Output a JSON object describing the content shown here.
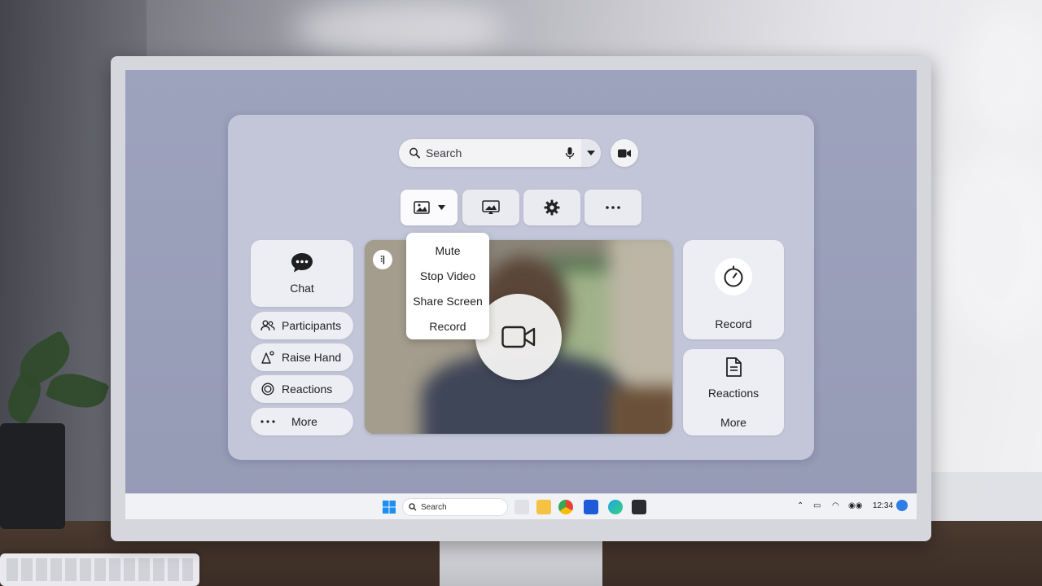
{
  "search": {
    "placeholder": "Search"
  },
  "dropdown_menu": {
    "items": [
      "Mute",
      "Stop Video",
      "Share Screen",
      "Record"
    ]
  },
  "left_panel": {
    "chat_label": "Chat",
    "pills": [
      {
        "label": "Participants",
        "icon": "participants-icon"
      },
      {
        "label": "Raise Hand",
        "icon": "raise-hand-icon"
      },
      {
        "label": "Reactions",
        "icon": "reactions-icon"
      },
      {
        "label": "More",
        "icon": "more-icon"
      }
    ]
  },
  "right_panel": {
    "record_label": "Record",
    "reactions_label": "Reactions",
    "more_label": "More"
  },
  "video": {
    "badge": "⫶|"
  },
  "taskbar": {
    "search_placeholder": "Search",
    "clock": "12:34"
  }
}
